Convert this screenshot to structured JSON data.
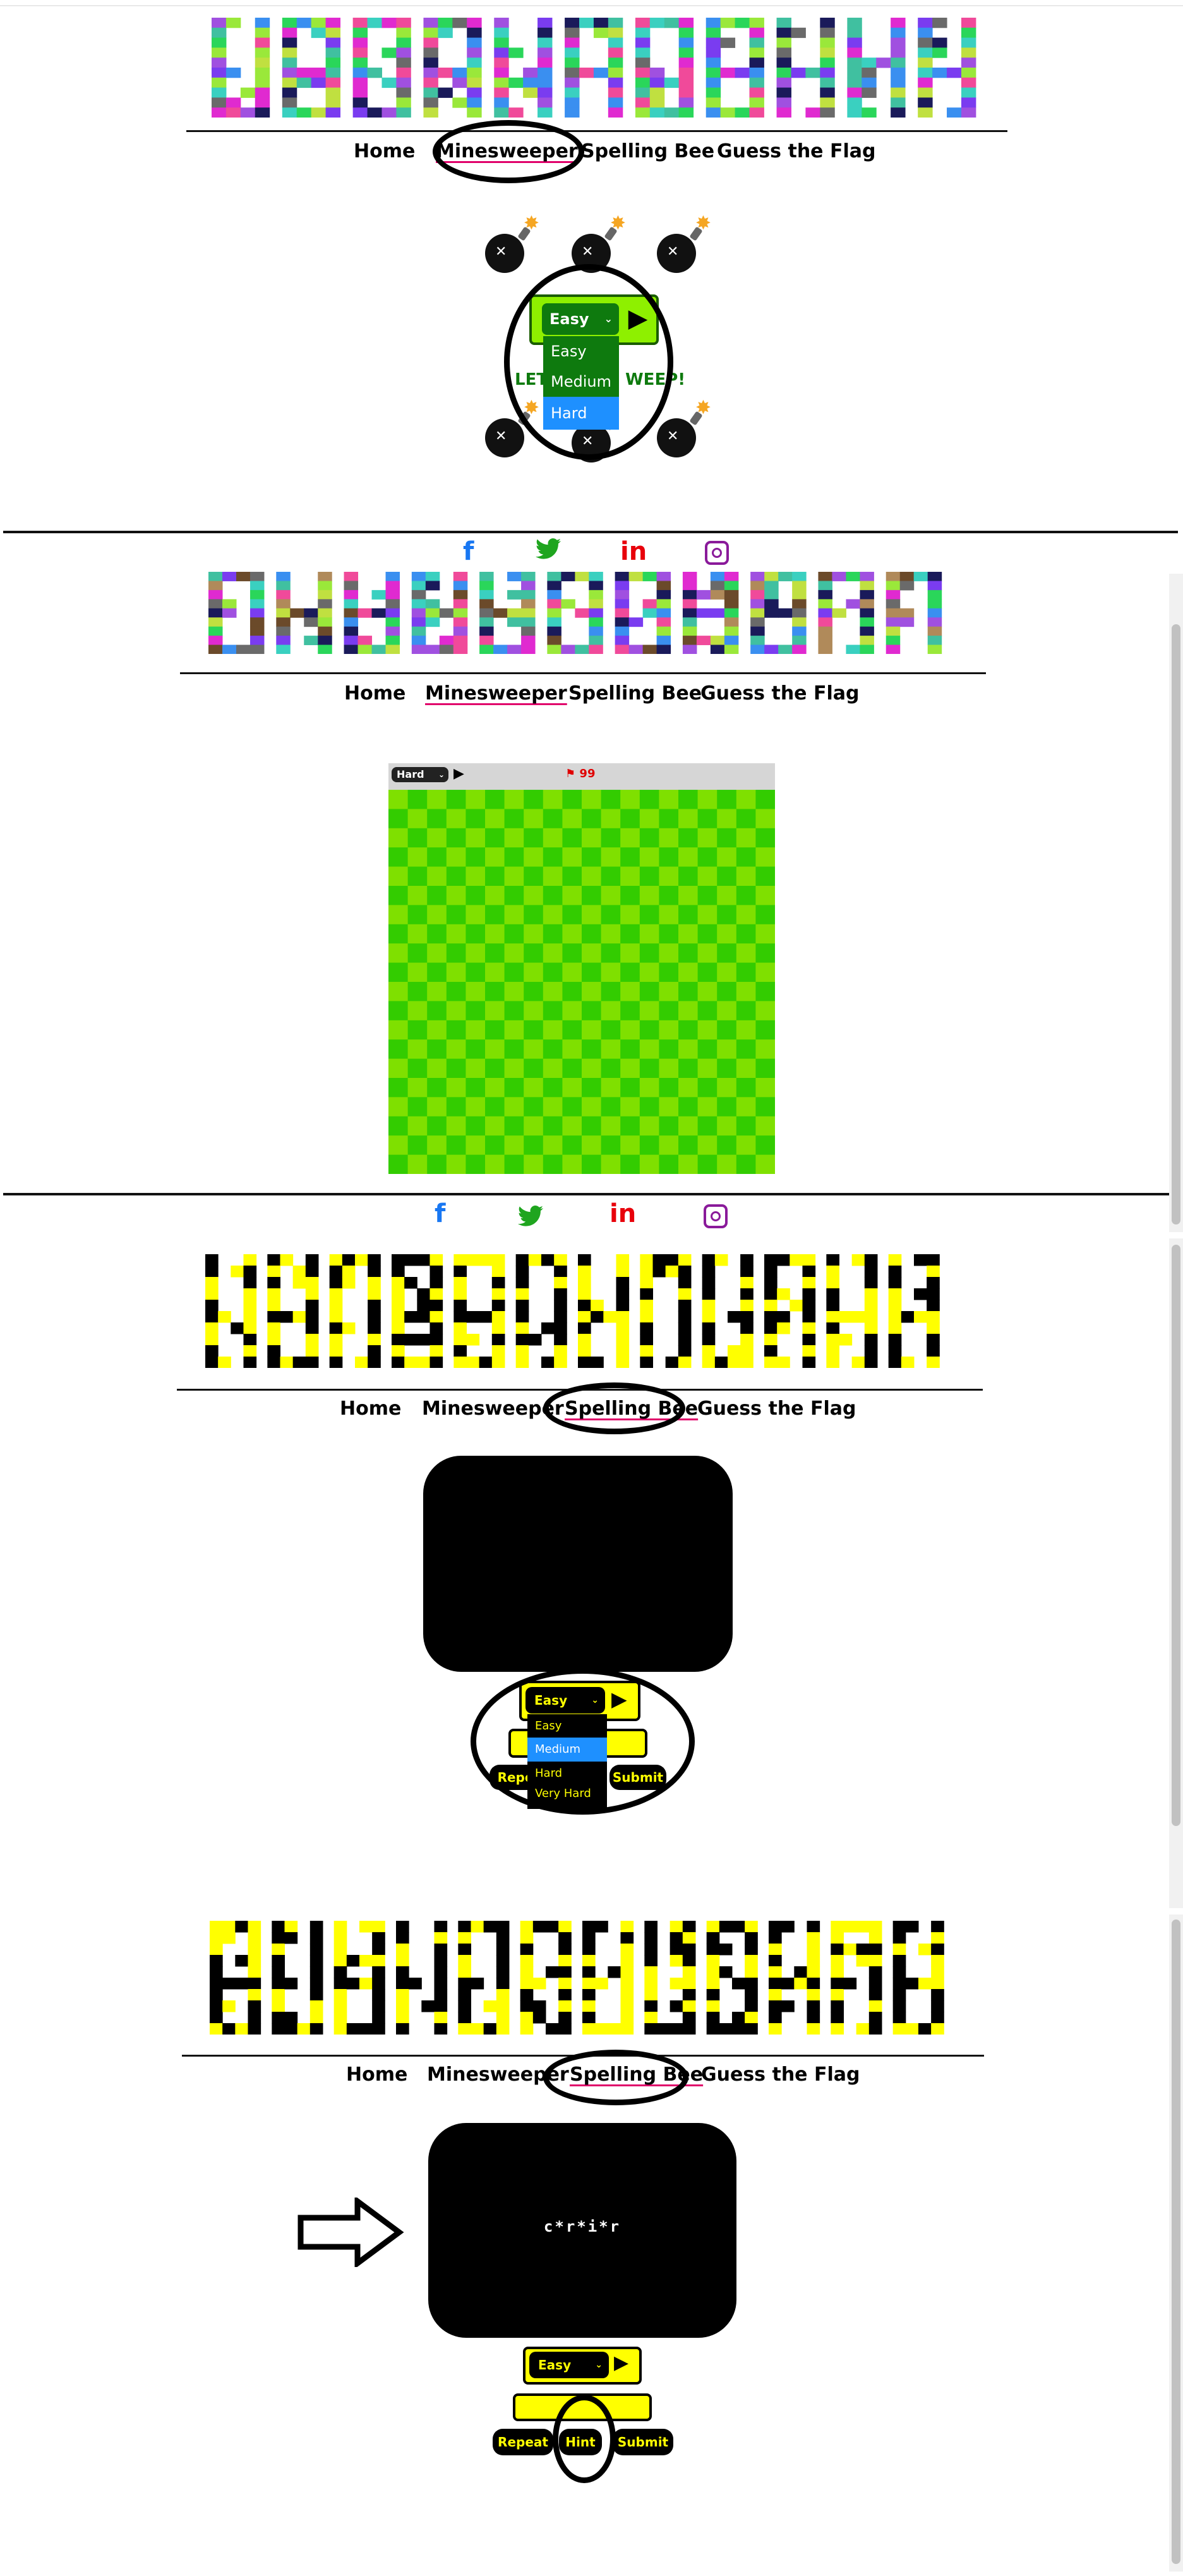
{
  "nav": {
    "home": "Home",
    "minesweeper": "Minesweeper",
    "spelling_bee": "Spelling Bee",
    "guess_flag": "Guess the Flag"
  },
  "social": {
    "facebook": "f",
    "twitter": "🐦",
    "linkedin": "in",
    "instagram": "◎"
  },
  "minesweeper": {
    "difficulty_selected": "Easy",
    "difficulty_options": [
      "Easy",
      "Medium",
      "Hard"
    ],
    "highlighted_option": "Hard",
    "intro_text": "LETS SWEEP!",
    "intro_text_left": "LET",
    "intro_text_right": "WEEP!",
    "board_difficulty": "Hard",
    "flag_count": "99",
    "play_icon": "play-icon",
    "flag_icon": "flag-icon"
  },
  "spelling_bee": {
    "difficulty_selected": "Easy",
    "difficulty_options": [
      "Easy",
      "Medium",
      "Hard",
      "Very Hard"
    ],
    "highlighted_option": "Medium",
    "repeat_label": "Repeat",
    "repeat_label_partial": "Repe",
    "hint_label": "Hint",
    "submit_label": "Submit",
    "hint_word": "c*r*i*r"
  },
  "colors": {
    "accent_pink": "#e0006a",
    "mine_green_light": "#7fe000",
    "mine_green_dark": "#33cc00",
    "bee_yellow": "#ffff00",
    "select_blue": "#1e90ff",
    "dropdown_green": "#0e7a0e"
  }
}
